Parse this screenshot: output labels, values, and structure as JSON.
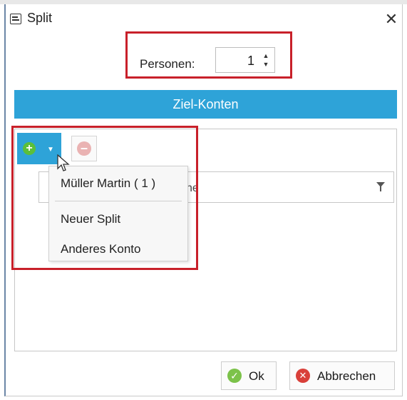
{
  "window": {
    "title": "Split",
    "close_glyph": "✕"
  },
  "personen": {
    "label": "Personen:",
    "value": "1"
  },
  "section": {
    "title": "Ziel-Konten"
  },
  "toolbar": {
    "add_icon": "plus-circle-icon",
    "remove_icon": "minus-circle-icon"
  },
  "menu": {
    "items": [
      {
        "label": "Müller Martin ( 1 )"
      },
      {
        "label": "Neuer Split"
      },
      {
        "label": "Anderes Konto"
      }
    ]
  },
  "grid": {
    "filter_partial_text": "ne"
  },
  "buttons": {
    "ok_label": "Ok",
    "cancel_label": "Abbrechen"
  },
  "colors": {
    "accent": "#2ea3d8",
    "highlight": "#c8202a",
    "ok_green": "#7cc24a",
    "cancel_red": "#d9403a"
  }
}
